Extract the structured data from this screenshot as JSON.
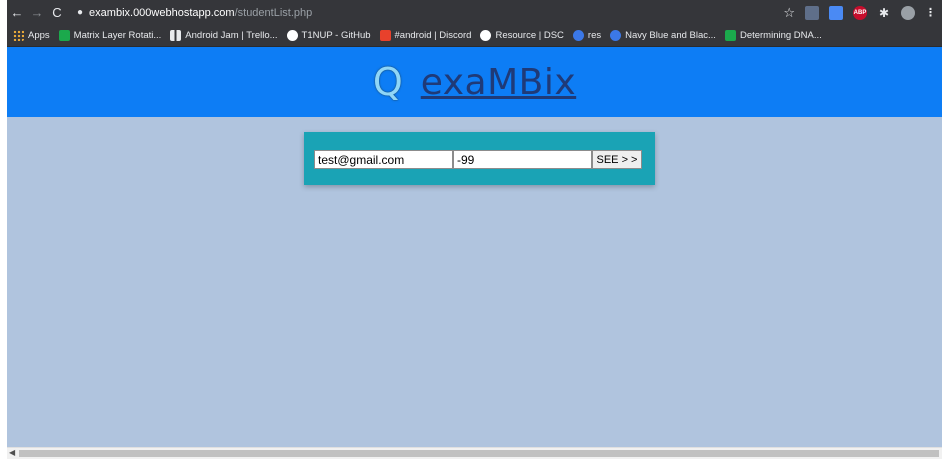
{
  "browser": {
    "url_host": "exambix.000webhostapp.com",
    "url_path": "/studentList.php",
    "back_icon": "←",
    "forward_icon": "→",
    "reload_icon": "C",
    "lock_icon": "🔒",
    "star_icon": "☆",
    "menu_icon": "⋮",
    "ext_abp_label": "ABP"
  },
  "bookmarks": [
    {
      "label": "Apps",
      "icon": "apps-grid-icon",
      "color": "#e8a93a"
    },
    {
      "label": "Matrix Layer Rotati...",
      "icon": "hackerrank-icon",
      "color": "#1ba94c"
    },
    {
      "label": "Android Jam | Trello...",
      "icon": "trello-icon",
      "color": "#e8eaed"
    },
    {
      "label": "T1NUP - GitHub",
      "icon": "github-icon",
      "color": "#ffffff"
    },
    {
      "label": "#android | Discord",
      "icon": "discord-icon",
      "color": "#e8412c"
    },
    {
      "label": "Resource | DSC",
      "icon": "github-icon",
      "color": "#ffffff"
    },
    {
      "label": "res",
      "icon": "c-icon",
      "color": "#3b78e7"
    },
    {
      "label": "Navy Blue and Blac...",
      "icon": "c-icon",
      "color": "#3b78e7"
    },
    {
      "label": "Determining DNA...",
      "icon": "hackerrank-icon",
      "color": "#1ba94c"
    }
  ],
  "header": {
    "logo_letter": "Q",
    "brand": "exaMBix",
    "background": "#0d7df5"
  },
  "form": {
    "email_value": "test@gmail.com",
    "number_value": "-99",
    "see_button_label": "SEE > >"
  },
  "colors": {
    "page_background": "#b0c4de",
    "form_background": "#1aa3b5"
  }
}
